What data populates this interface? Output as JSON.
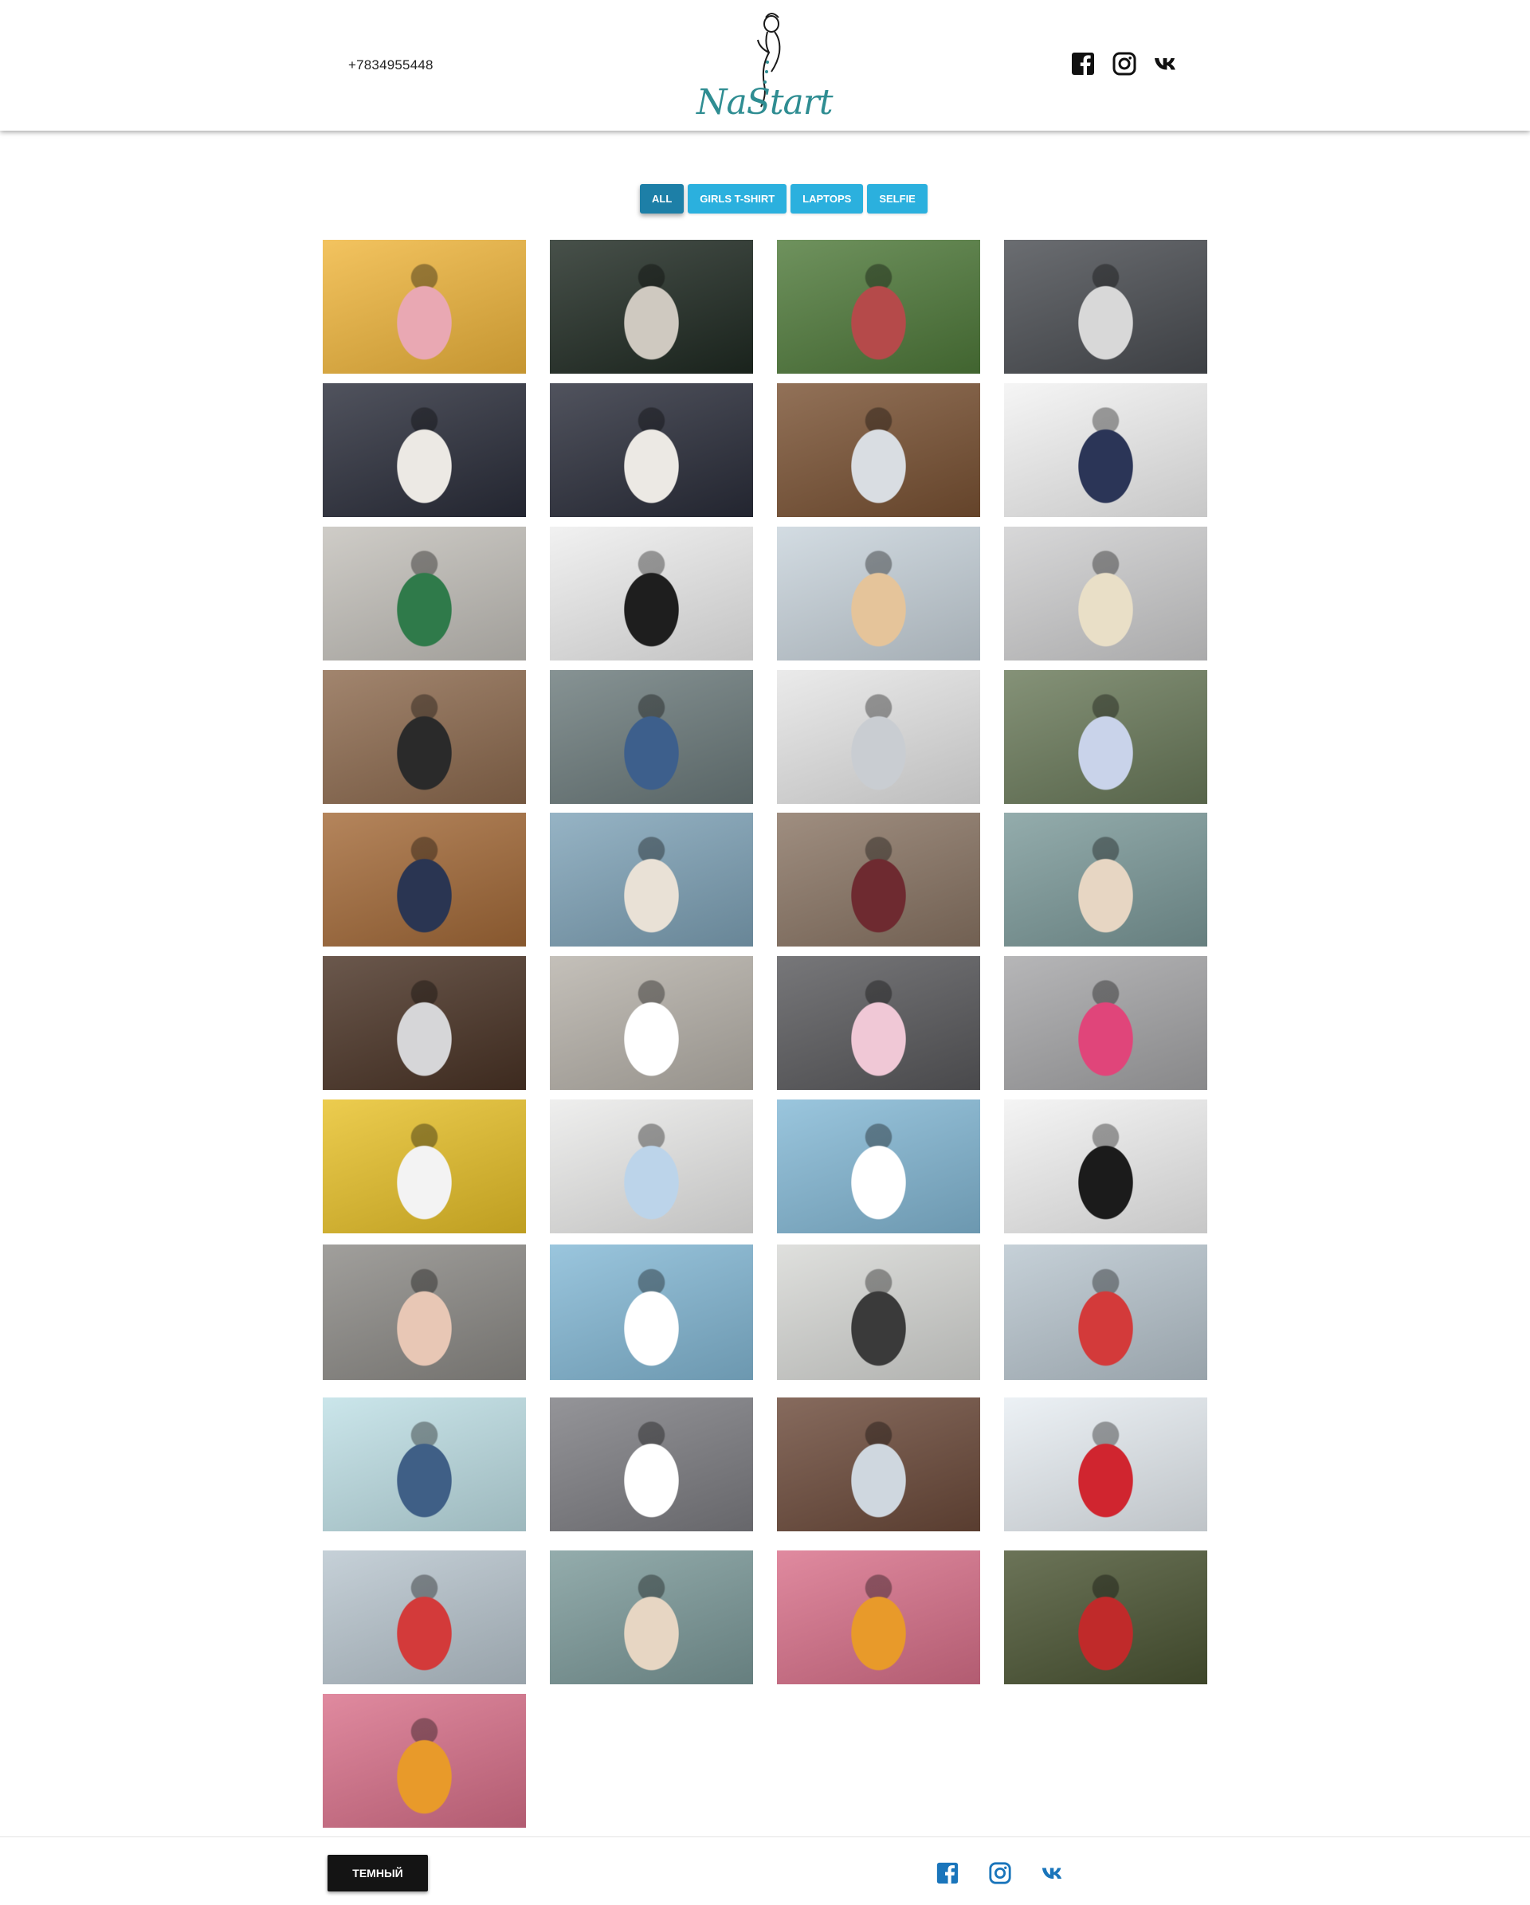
{
  "header": {
    "phone": "+7834955448",
    "logo_text": "NaStart",
    "social": [
      "facebook-icon",
      "instagram-icon",
      "vk-icon"
    ]
  },
  "filters": [
    {
      "label": "ALL",
      "active": true
    },
    {
      "label": "GIRLS T-SHIRT",
      "active": false
    },
    {
      "label": "LAPTOPS",
      "active": false
    },
    {
      "label": "SELFIE",
      "active": false
    }
  ],
  "gallery": {
    "items": [
      {
        "subject": "selfie-yellow",
        "bg": "#f0b63c",
        "fg": "#e9a8b3"
      },
      {
        "subject": "girl-car",
        "bg": "#1f2a22",
        "fg": "#cfc9c0"
      },
      {
        "subject": "selfie-garden",
        "bg": "#4f7a3a",
        "fg": "#b54a4a"
      },
      {
        "subject": "three-girls-tshirt",
        "bg": "#4a4d52",
        "fg": "#d8d8d8"
      },
      {
        "subject": "two-girls-stripes",
        "bg": "#2a2d3a",
        "fg": "#ece9e4"
      },
      {
        "subject": "girl-stripes",
        "bg": "#2a2d3a",
        "fg": "#ece9e4"
      },
      {
        "subject": "laptop-desk",
        "bg": "#7a5233",
        "fg": "#d9dde2"
      },
      {
        "subject": "mockup-devices",
        "bg": "#f3f3f3",
        "fg": "#2b3557"
      },
      {
        "subject": "girl-green-jacket",
        "bg": "#c4c1bb",
        "fg": "#2f7a4a"
      },
      {
        "subject": "laptop-white",
        "bg": "#eeeeee",
        "fg": "#1e1e1e"
      },
      {
        "subject": "girl-kitchen",
        "bg": "#c9d4dc",
        "fg": "#e5c49a"
      },
      {
        "subject": "girl-tshirt-grey",
        "bg": "#cfcfd0",
        "fg": "#e9dfc7"
      },
      {
        "subject": "girl-street",
        "bg": "#8d6a4e",
        "fg": "#2a2a2a"
      },
      {
        "subject": "girl-laptop-denim",
        "bg": "#6c7b7c",
        "fg": "#3d5f8c"
      },
      {
        "subject": "laptop-website",
        "bg": "#e6e6e6",
        "fg": "#c9cdd2"
      },
      {
        "subject": "girl-white-top",
        "bg": "#6a7a5a",
        "fg": "#c9d3ea"
      },
      {
        "subject": "girl-skateboard",
        "bg": "#a46a38",
        "fg": "#2a3552"
      },
      {
        "subject": "couple-sea",
        "bg": "#7fa3b8",
        "fg": "#e9e1d6"
      },
      {
        "subject": "group-selfie",
        "bg": "#8a7564",
        "fg": "#6e2a30"
      },
      {
        "subject": "friends-selfie",
        "bg": "#7c9a9a",
        "fg": "#e7d6c3"
      },
      {
        "subject": "laptop-flowers",
        "bg": "#4a3325",
        "fg": "#d6d6d8"
      },
      {
        "subject": "laptop-blank",
        "bg": "#b7b2aa",
        "fg": "#ffffff"
      },
      {
        "subject": "laptop-chart",
        "bg": "#59595c",
        "fg": "#f0c8d6"
      },
      {
        "subject": "girl-stairs",
        "bg": "#a6a6a8",
        "fg": "#e0457a"
      },
      {
        "subject": "girl-balloons",
        "bg": "#e8c128",
        "fg": "#f3f3f3"
      },
      {
        "subject": "girl-brick-wall",
        "bg": "#ebebea",
        "fg": "#bcd4ea"
      },
      {
        "subject": "laptop-sticky-notes",
        "bg": "#84b9d6",
        "fg": "#ffffff"
      },
      {
        "subject": "girl-laptop-office",
        "bg": "#f2f2f2",
        "fg": "#1b1b1b"
      },
      {
        "subject": "laptop-plants",
        "bg": "#8c8a86",
        "fg": "#e8c7b5"
      },
      {
        "subject": "laptop-sticky-notes-2",
        "bg": "#84b9d6",
        "fg": "#ffffff"
      },
      {
        "subject": "laptop-phone",
        "bg": "#d8d9d6",
        "fg": "#3a3a3a"
      },
      {
        "subject": "girl-sunglasses",
        "bg": "#b9c6cf",
        "fg": "#d33a3a"
      },
      {
        "subject": "couple-selfie",
        "bg": "#bfe0e6",
        "fg": "#3f5f86"
      },
      {
        "subject": "laptop-lap",
        "bg": "#7d7d82",
        "fg": "#ffffff"
      },
      {
        "subject": "group-phone",
        "bg": "#6c4a3a",
        "fg": "#cfd7df"
      },
      {
        "subject": "girl-selfie-sky",
        "bg": "#e8eef3",
        "fg": "#d0252f"
      },
      {
        "subject": "girl-sunglasses-2",
        "bg": "#b9c6cf",
        "fg": "#d33a3a"
      },
      {
        "subject": "friends-selfie-2",
        "bg": "#7c9a9a",
        "fg": "#e7d6c3"
      },
      {
        "subject": "two-girls-pink",
        "bg": "#d9708a",
        "fg": "#e89a2a"
      },
      {
        "subject": "girls-car-hills",
        "bg": "#4b5533",
        "fg": "#c02a2a"
      },
      {
        "subject": "two-girls-pink-2",
        "bg": "#d9708a",
        "fg": "#e89a2a"
      }
    ]
  },
  "footer": {
    "theme_button": "ТЕМНЫЙ",
    "social": [
      "facebook-icon",
      "instagram-icon",
      "vk-icon"
    ]
  }
}
